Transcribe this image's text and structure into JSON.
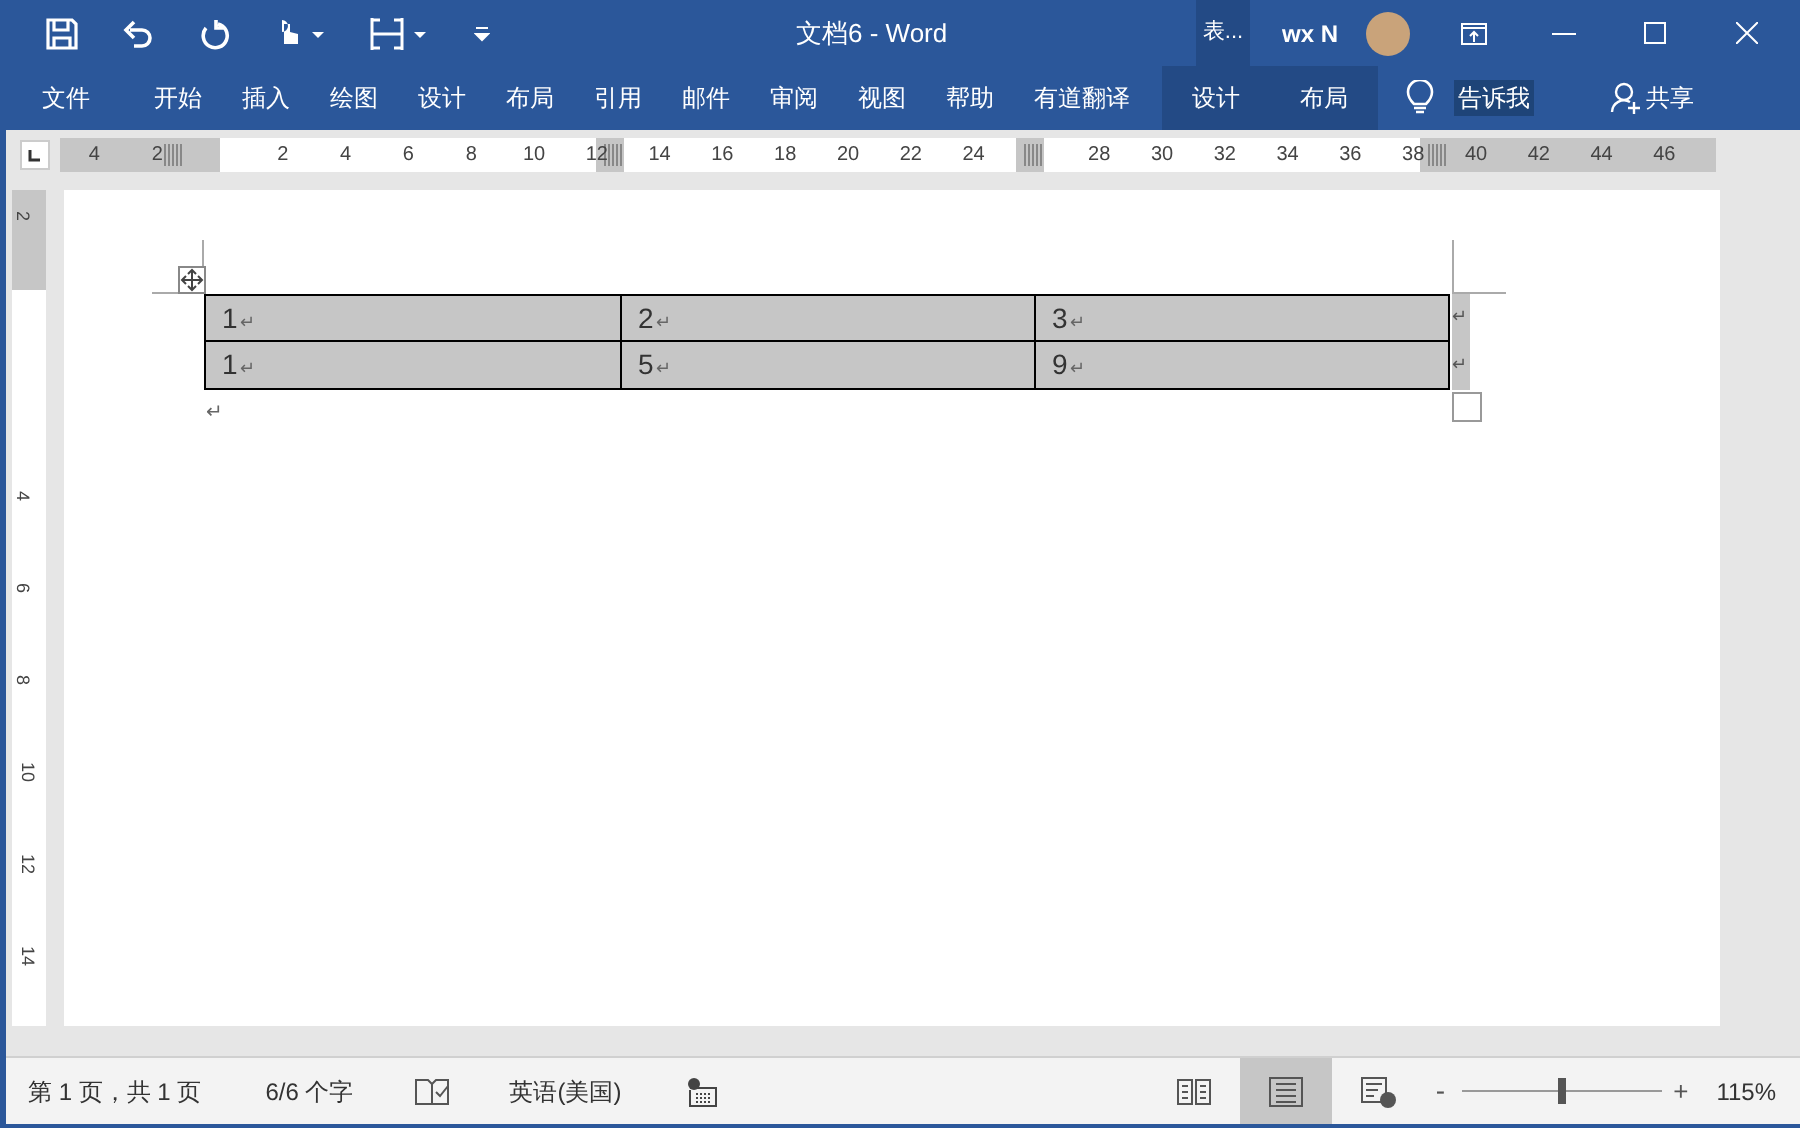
{
  "window": {
    "title": "文档6 - Word",
    "contextual_group": "表...",
    "user": "wx N"
  },
  "ribbon_tabs": [
    {
      "label": "文件",
      "contextual": false
    },
    {
      "label": "开始",
      "contextual": false
    },
    {
      "label": "插入",
      "contextual": false
    },
    {
      "label": "绘图",
      "contextual": false
    },
    {
      "label": "设计",
      "contextual": false
    },
    {
      "label": "布局",
      "contextual": false
    },
    {
      "label": "引用",
      "contextual": false
    },
    {
      "label": "邮件",
      "contextual": false
    },
    {
      "label": "审阅",
      "contextual": false
    },
    {
      "label": "视图",
      "contextual": false
    },
    {
      "label": "帮助",
      "contextual": false
    },
    {
      "label": "有道翻译",
      "contextual": false
    },
    {
      "label": "设计",
      "contextual": true
    },
    {
      "label": "布局",
      "contextual": true
    }
  ],
  "tell_me": "告诉我",
  "share": "共享",
  "horizontal_ruler": [
    "4",
    "2",
    "2",
    "4",
    "6",
    "8",
    "10",
    "12",
    "14",
    "16",
    "18",
    "20",
    "22",
    "24",
    "28",
    "30",
    "32",
    "34",
    "36",
    "38",
    "40",
    "42",
    "44",
    "46"
  ],
  "vertical_ruler": [
    "2",
    "4",
    "6",
    "8",
    "10",
    "12",
    "14"
  ],
  "table": {
    "rows": [
      {
        "cells": [
          {
            "text": "1",
            "mark": "↵"
          },
          {
            "text": "2",
            "mark": "↵"
          },
          {
            "text": "3",
            "mark": "↵"
          }
        ],
        "end_mark": "↵"
      },
      {
        "cells": [
          {
            "text": "1",
            "mark": "↵"
          },
          {
            "text": "5",
            "mark": "↵"
          },
          {
            "text": "9",
            "mark": "↵"
          }
        ],
        "end_mark": "↵"
      }
    ],
    "shaded": true,
    "paragraph_mark": "↵"
  },
  "status_bar": {
    "page": "第 1 页，共 1 页",
    "words": "6/6 个字",
    "language": "英语(美国)",
    "views": [
      {
        "kind": "read",
        "selected": false
      },
      {
        "kind": "print",
        "selected": true
      },
      {
        "kind": "web",
        "selected": false
      }
    ],
    "zoom": {
      "minus": "-",
      "plus": "+",
      "level": 0.5,
      "reading": "115%"
    }
  }
}
